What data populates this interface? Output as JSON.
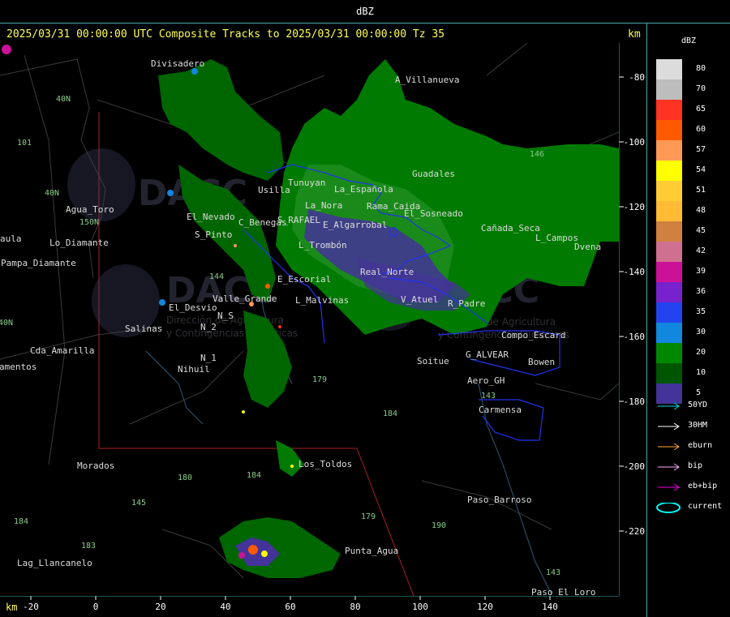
{
  "window": {
    "title": "dBZ"
  },
  "header": {
    "text": "2025/03/31 00:00:00 UTC Composite Tracks to 2025/03/31 00:00:00 Tz 35",
    "km_top": "km",
    "km_bottom": "km"
  },
  "axes": {
    "y_ticks": [
      "-80",
      "-100",
      "-120",
      "-140",
      "-160",
      "-180",
      "-200",
      "-220"
    ],
    "x_ticks": [
      "-20",
      "0",
      "20",
      "40",
      "60",
      "80",
      "100",
      "120",
      "140"
    ]
  },
  "legend": {
    "unit": "dBZ",
    "scale": [
      {
        "label": "80",
        "color": "#dcdcdc"
      },
      {
        "label": "70",
        "color": "#bdbdbd"
      },
      {
        "label": "65",
        "color": "#ff3322"
      },
      {
        "label": "60",
        "color": "#ff5a00"
      },
      {
        "label": "57",
        "color": "#ff9955"
      },
      {
        "label": "54",
        "color": "#ffff00"
      },
      {
        "label": "51",
        "color": "#ffcc33"
      },
      {
        "label": "48",
        "color": "#ffbb33"
      },
      {
        "label": "45",
        "color": "#d08040"
      },
      {
        "label": "42",
        "color": "#d07090"
      },
      {
        "label": "39",
        "color": "#cc1199"
      },
      {
        "label": "36",
        "color": "#7722cc"
      },
      {
        "label": "35",
        "color": "#2244ee"
      },
      {
        "label": "30",
        "color": "#1188dd"
      },
      {
        "label": "20",
        "color": "#008800"
      },
      {
        "label": "10",
        "color": "#005500"
      },
      {
        "label": "5",
        "color": "#443399"
      }
    ],
    "tracks": [
      {
        "label": "50YD",
        "color": "#00dddd",
        "shape": "arrow"
      },
      {
        "label": "30HM",
        "color": "#ffffff",
        "shape": "arrow"
      },
      {
        "label": "eburn",
        "color": "#ffaa33",
        "shape": "arrow"
      },
      {
        "label": "bip",
        "color": "#ffaaff",
        "shape": "arrow"
      },
      {
        "label": "eb+bip",
        "color": "#ee00ee",
        "shape": "arrow"
      },
      {
        "label": "current",
        "color": "#00ffff",
        "shape": "ellipse"
      }
    ]
  },
  "map": {
    "places": [
      {
        "id": "divisadero",
        "label": "Divisadero"
      },
      {
        "id": "a-villanueva",
        "label": "A_Villanueva"
      },
      {
        "id": "aqua-toro",
        "label": "Agua_Toro"
      },
      {
        "id": "guadales",
        "label": "Guadales"
      },
      {
        "id": "tunuyan",
        "label": "Tunuyan"
      },
      {
        "id": "usilla",
        "label": "Usilla"
      },
      {
        "id": "la-espanola",
        "label": "La_Española"
      },
      {
        "id": "la-mora",
        "label": "La_Nora"
      },
      {
        "id": "rama-caida",
        "label": "Rama_Caida"
      },
      {
        "id": "el-sosneado",
        "label": "El_Sosneado"
      },
      {
        "id": "canada-seca",
        "label": "Cañada_Seca"
      },
      {
        "id": "los-campos",
        "label": "L_Campos"
      },
      {
        "id": "el-nevado",
        "label": "El_Nevado"
      },
      {
        "id": "s-pinto",
        "label": "S_Pinto"
      },
      {
        "id": "c-benegas",
        "label": "C_Benegas"
      },
      {
        "id": "s-rafael",
        "label": "S_RAFAEL"
      },
      {
        "id": "el-algarrobal",
        "label": "E_Algarrobal"
      },
      {
        "id": "el-tromban",
        "label": "L_Trombón"
      },
      {
        "id": "el-escorial",
        "label": "E_Escorial"
      },
      {
        "id": "real-norte",
        "label": "Real_Norte"
      },
      {
        "id": "pampa-diamante",
        "label": "Pampa_Diamante"
      },
      {
        "id": "el-desvio",
        "label": "El_Desvio"
      },
      {
        "id": "valle-grande",
        "label": "Valle_Grande"
      },
      {
        "id": "l-malvinas",
        "label": "L_Malvinas"
      },
      {
        "id": "v-atuel",
        "label": "V_Atuel"
      },
      {
        "id": "r-padre",
        "label": "R_Padre"
      },
      {
        "id": "salinas",
        "label": "Salinas"
      },
      {
        "id": "n2",
        "label": "N_2"
      },
      {
        "id": "n1",
        "label": "N_1"
      },
      {
        "id": "ns",
        "label": "N_S"
      },
      {
        "id": "cda-amarilla",
        "label": "Cda_Amarilla"
      },
      {
        "id": "nihuil",
        "label": "Nihuil"
      },
      {
        "id": "soitue",
        "label": "Soitue"
      },
      {
        "id": "g-alvear",
        "label": "G_ALVEAR"
      },
      {
        "id": "bowen",
        "label": "Bowen"
      },
      {
        "id": "comp-escard",
        "label": "Compo_Escard"
      },
      {
        "id": "aero-gh",
        "label": "Aero_GH"
      },
      {
        "id": "carmensa",
        "label": "Carmensa"
      },
      {
        "id": "morados",
        "label": "Morados"
      },
      {
        "id": "los-toldos",
        "label": "Los_Toldos"
      },
      {
        "id": "paso-barroso",
        "label": "Paso_Barroso"
      },
      {
        "id": "lag-llancanelo",
        "label": "Lag_Llancanelo"
      },
      {
        "id": "punta-agua",
        "label": "Punta_Agua"
      },
      {
        "id": "paso-el-loro",
        "label": "Paso_El_Loro"
      },
      {
        "id": "camentos",
        "label": "amentos"
      },
      {
        "id": "aula",
        "label": "aula"
      },
      {
        "id": "dvena",
        "label": "Dvena"
      },
      {
        "id": "lo-diamante",
        "label": "Lo_Diamante"
      }
    ],
    "roads": [
      "40N",
      "101",
      "40N",
      "40N",
      "150N",
      "144",
      "179",
      "184",
      "180",
      "184",
      "179",
      "190",
      "143",
      "183",
      "184",
      "143",
      "146",
      "145"
    ],
    "watermark": {
      "brand": "DACC",
      "line1": "Dirección de Agricultura",
      "line2": "y Contingencias Climáticas"
    }
  }
}
